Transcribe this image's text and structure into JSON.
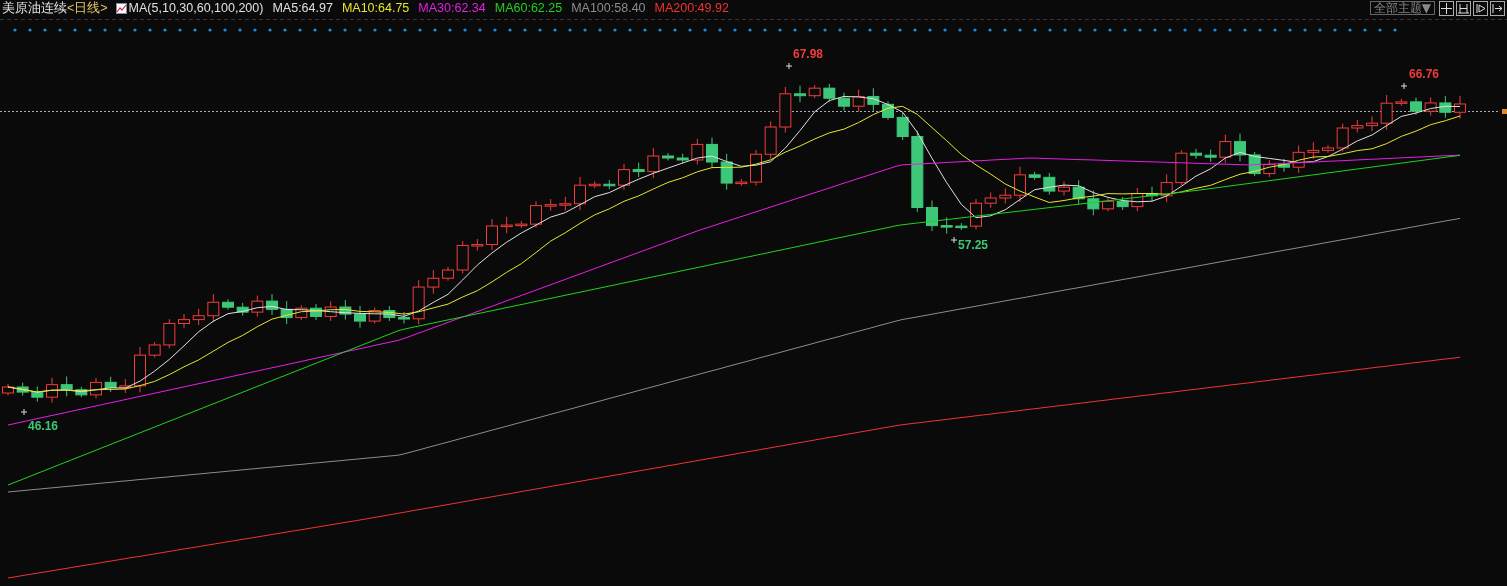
{
  "header": {
    "title": "美原油连续",
    "period": "<日线>",
    "ma_legend": [
      {
        "label": "MA(5,10,30,60,100,200)",
        "color": "#e0e0e0",
        "kind": "params"
      },
      {
        "label": "MA5:64.97",
        "color": "#e0e0e0",
        "kind": "line"
      },
      {
        "label": "MA10:64.75",
        "color": "#e6e62e",
        "kind": "line"
      },
      {
        "label": "MA30:62.34",
        "color": "#e61ee6",
        "kind": "line"
      },
      {
        "label": "MA60:62.25",
        "color": "#1ed21e",
        "kind": "line"
      },
      {
        "label": "MA100:58.40",
        "color": "#8c8c8c",
        "kind": "line"
      },
      {
        "label": "MA200:49.92",
        "color": "#f03232",
        "kind": "line"
      }
    ]
  },
  "toolbar": {
    "theme_button": "全部主题▼"
  },
  "price_labels": [
    {
      "text": "67.98",
      "kind": "high"
    },
    {
      "text": "46.16",
      "kind": "low"
    },
    {
      "text": "57.25",
      "kind": "low"
    },
    {
      "text": "66.76",
      "kind": "high"
    }
  ]
}
